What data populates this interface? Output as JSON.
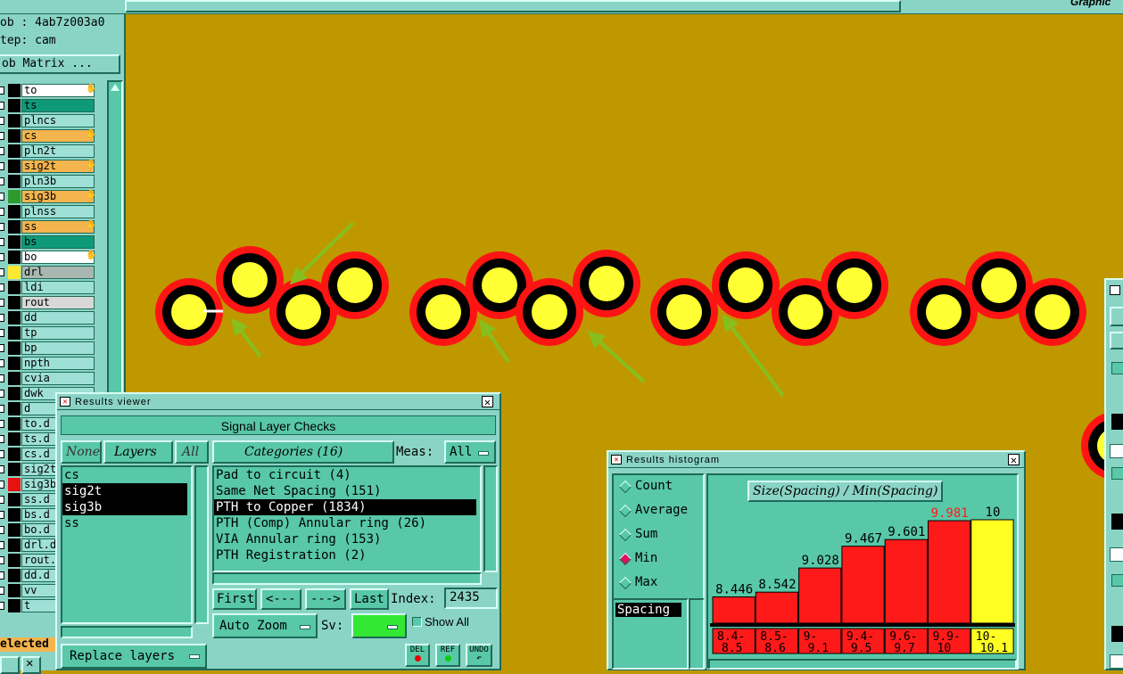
{
  "topbar": {
    "right_title": "Graphic"
  },
  "left_panel": {
    "job_label": "ob : 4ab7z003a0",
    "step_label": "tep: cam",
    "job_matrix_button": "ob Matrix ...",
    "layers": [
      {
        "name": "to",
        "bg": "#ffffff",
        "swatch": "#000000",
        "hand": true
      },
      {
        "name": "ts",
        "bg": "#0e9a78",
        "swatch": "#000000",
        "hand": false
      },
      {
        "name": "plncs",
        "bg": "#9ee0d6",
        "swatch": "#000000",
        "hand": false
      },
      {
        "name": "cs",
        "bg": "#f4b44e",
        "swatch": "#000000",
        "hand": true
      },
      {
        "name": "pln2t",
        "bg": "#9ee0d6",
        "swatch": "#000000",
        "hand": false
      },
      {
        "name": "sig2t",
        "bg": "#f4b44e",
        "swatch": "#000000",
        "hand": true
      },
      {
        "name": "pln3b",
        "bg": "#9ee0d6",
        "swatch": "#000000",
        "hand": false
      },
      {
        "name": "sig3b",
        "bg": "#f4b44e",
        "swatch": "#2e9a2e",
        "hand": true
      },
      {
        "name": "plnss",
        "bg": "#9ee0d6",
        "swatch": "#000000",
        "hand": false
      },
      {
        "name": "ss",
        "bg": "#f4b44e",
        "swatch": "#000000",
        "hand": true
      },
      {
        "name": "bs",
        "bg": "#0e9a78",
        "swatch": "#000000",
        "hand": false
      },
      {
        "name": "bo",
        "bg": "#ffffff",
        "swatch": "#000000",
        "hand": true
      },
      {
        "name": "drl",
        "bg": "#a8b8b0",
        "swatch": "#ffe830",
        "hand": false
      },
      {
        "name": "ldi",
        "bg": "#9ee0d6",
        "swatch": "#000000",
        "hand": false
      },
      {
        "name": "rout",
        "bg": "#d8d8d8",
        "swatch": "#000000",
        "hand": false
      },
      {
        "name": "dd",
        "bg": "#9ee0d6",
        "swatch": "#000000",
        "hand": false
      },
      {
        "name": "tp",
        "bg": "#9ee0d6",
        "swatch": "#000000",
        "hand": false
      },
      {
        "name": "bp",
        "bg": "#9ee0d6",
        "swatch": "#000000",
        "hand": false
      },
      {
        "name": "npth",
        "bg": "#9ee0d6",
        "swatch": "#000000",
        "hand": false
      },
      {
        "name": "cvia",
        "bg": "#9ee0d6",
        "swatch": "#000000",
        "hand": false
      },
      {
        "name": "dwk",
        "bg": "#9ee0d6",
        "swatch": "#000000",
        "hand": false
      },
      {
        "name": "d",
        "bg": "#9ee0d6",
        "swatch": "#000000",
        "hand": false
      },
      {
        "name": "to.d",
        "bg": "#9ee0d6",
        "swatch": "#000000",
        "hand": false
      },
      {
        "name": "ts.d",
        "bg": "#9ee0d6",
        "swatch": "#000000",
        "hand": false
      },
      {
        "name": "cs.d",
        "bg": "#9ee0d6",
        "swatch": "#000000",
        "hand": false
      },
      {
        "name": "sig2t",
        "bg": "#9ee0d6",
        "swatch": "#000000",
        "hand": false
      },
      {
        "name": "sig3b",
        "bg": "#9ee0d6",
        "swatch": "#e81010",
        "hand": false
      },
      {
        "name": "ss.d",
        "bg": "#9ee0d6",
        "swatch": "#000000",
        "hand": false
      },
      {
        "name": "bs.d",
        "bg": "#9ee0d6",
        "swatch": "#000000",
        "hand": false
      },
      {
        "name": "bo.d",
        "bg": "#9ee0d6",
        "swatch": "#000000",
        "hand": false
      },
      {
        "name": "drl.d",
        "bg": "#9ee0d6",
        "swatch": "#000000",
        "hand": false
      },
      {
        "name": "rout.",
        "bg": "#9ee0d6",
        "swatch": "#000000",
        "hand": false
      },
      {
        "name": "dd.d",
        "bg": "#9ee0d6",
        "swatch": "#000000",
        "hand": false
      },
      {
        "name": "vv",
        "bg": "#9ee0d6",
        "swatch": "#000000",
        "hand": false
      },
      {
        "name": "t",
        "bg": "#9ee0d6",
        "swatch": "#000000",
        "hand": false
      }
    ],
    "selected_label": "elected :"
  },
  "results_viewer": {
    "title": "Results viewer",
    "check_name": "Signal Layer Checks",
    "none_button": "None",
    "layers_button": "Layers",
    "all_button": "All",
    "layer_list": [
      {
        "name": "cs",
        "selected": false
      },
      {
        "name": "sig2t",
        "selected": true
      },
      {
        "name": "sig3b",
        "selected": true
      },
      {
        "name": "ss",
        "selected": false
      }
    ],
    "categories_button": "Categories (16)",
    "meas_label": "Meas:",
    "meas_value": "All",
    "categories": [
      {
        "label": "Pad to circuit (4)",
        "selected": false
      },
      {
        "label": "Same Net Spacing (151)",
        "selected": false
      },
      {
        "label": "PTH to Copper (1834)",
        "selected": true
      },
      {
        "label": "PTH (Comp) Annular ring (26)",
        "selected": false
      },
      {
        "label": "VIA Annular ring (153)",
        "selected": false
      },
      {
        "label": "PTH Registration (2)",
        "selected": false
      }
    ],
    "first_button": "First",
    "prev_button": "<---",
    "next_button": "--->",
    "last_button": "Last",
    "index_label": "Index:",
    "index_value": "2435",
    "auto_zoom_button": "Auto Zoom",
    "sv_label": "Sv:",
    "sv_color": "#33e833",
    "show_all_label": "Show All",
    "replace_layers_button": "Replace layers",
    "del_button": "DEL",
    "ref_button": "REF",
    "undo_button": "UNDO"
  },
  "results_histogram": {
    "title": "Results histogram",
    "options": [
      {
        "label": "Count",
        "selected": false
      },
      {
        "label": "Average",
        "selected": false
      },
      {
        "label": "Sum",
        "selected": false
      },
      {
        "label": "Min",
        "selected": true
      },
      {
        "label": "Max",
        "selected": false
      }
    ],
    "list_item": "Spacing",
    "chart_title": "Size(Spacing) / Min(Spacing)"
  },
  "chart_data": {
    "type": "bar",
    "title": "Size(Spacing) / Min(Spacing)",
    "categories": [
      "8.4-8.5",
      "8.5-8.6",
      "9-9.1",
      "9.4-9.5",
      "9.6-9.7",
      "9.9-10",
      "10-10.1"
    ],
    "values": [
      8.446,
      8.542,
      9.028,
      9.467,
      9.601,
      9.981,
      10
    ],
    "value_labels": [
      "8.446",
      "8.542",
      "9.028",
      "9.467",
      "9.601",
      "9.981",
      "10"
    ],
    "tick_lines": [
      [
        "8.4-",
        "8.5"
      ],
      [
        "8.5-",
        "8.6"
      ],
      [
        "9-",
        "9.1"
      ],
      [
        "9.4-",
        "9.5"
      ],
      [
        "9.6-",
        "9.7"
      ],
      [
        "9.9-",
        "10"
      ],
      [
        "10-",
        "10.1"
      ]
    ],
    "bar_colors": [
      "#ff1a1a",
      "#ff1a1a",
      "#ff1a1a",
      "#ff1a1a",
      "#ff1a1a",
      "#ff1a1a",
      "#ffff22"
    ],
    "label_colors": [
      "#000000",
      "#000000",
      "#000000",
      "#000000",
      "#000000",
      "#ff1a1a",
      "#000000"
    ],
    "ylim": [
      8,
      10
    ],
    "xlabel": "",
    "ylabel": ""
  }
}
